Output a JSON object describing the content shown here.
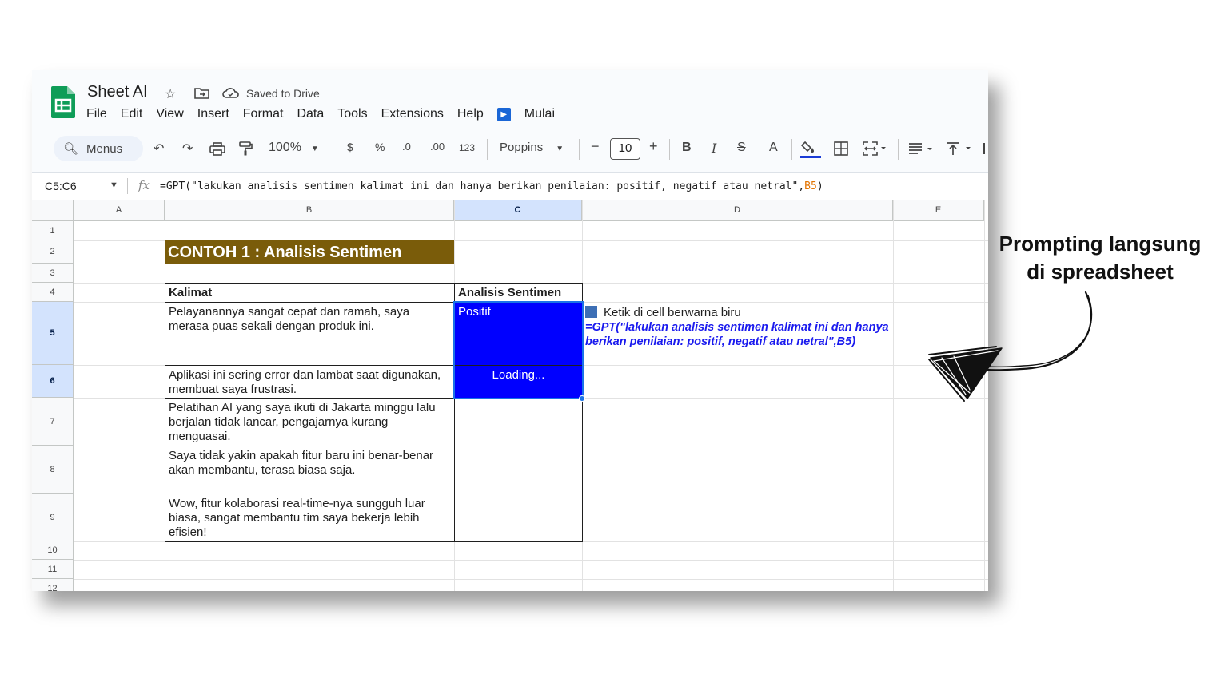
{
  "app": {
    "doc_title": "Sheet AI",
    "saved_status": "Saved to Drive",
    "menus": [
      "File",
      "Edit",
      "View",
      "Insert",
      "Format",
      "Data",
      "Tools",
      "Extensions",
      "Help"
    ],
    "addon_menu": "Mulai"
  },
  "toolbar": {
    "search_label": "Menus",
    "zoom": "100%",
    "currency": "$",
    "percent": "%",
    "decrease_decimals": ".0",
    "increase_decimals": ".00",
    "number_format": "123",
    "font": "Poppins",
    "font_size": "10",
    "bold": "B",
    "italic": "I",
    "text_color": "A"
  },
  "formula_bar": {
    "name_box": "C5:C6",
    "fx": "fx",
    "formula_text": "=GPT(\"lakukan analisis sentimen kalimat ini dan hanya berikan penilaian: positif, negatif atau netral\",",
    "formula_ref": "B5",
    "formula_close": ")"
  },
  "grid": {
    "columns": [
      "A",
      "B",
      "C",
      "D",
      "E"
    ],
    "rows": [
      "1",
      "2",
      "3",
      "4",
      "5",
      "6",
      "7",
      "8",
      "9",
      "10",
      "11",
      "12"
    ],
    "title_cell": "CONTOH 1 : Analisis Sentimen",
    "header_kalimat": "Kalimat",
    "header_sentimen": "Analisis Sentimen",
    "sentences": [
      "Pelayanannya sangat cepat dan ramah, saya merasa puas sekali dengan produk ini.",
      "Aplikasi ini sering error dan lambat saat digunakan, membuat saya frustrasi.",
      "Pelatihan AI yang saya ikuti di Jakarta minggu lalu berjalan tidak lancar, pengajarnya kurang menguasai.",
      "Saya tidak yakin apakah fitur baru ini benar-benar akan membantu, terasa biasa saja.",
      "Wow, fitur kolaborasi real-time-nya sungguh luar biasa, sangat membantu tim saya bekerja lebih efisien!"
    ],
    "results": [
      "Positif",
      "Loading...",
      "",
      "",
      ""
    ],
    "annotation_title": "Ketik di cell berwarna biru",
    "annotation_formula": "=GPT(\"lakukan analisis sentimen kalimat ini dan hanya berikan penilaian: positif, negatif atau netral\",B5)"
  },
  "side_note": {
    "line1": "Prompting langsung",
    "line2": "di spreadsheet"
  },
  "colors": {
    "title_fill": "#7a5c0a",
    "selected_fill": "#0000ff",
    "annotation_text": "#1a1aee"
  }
}
